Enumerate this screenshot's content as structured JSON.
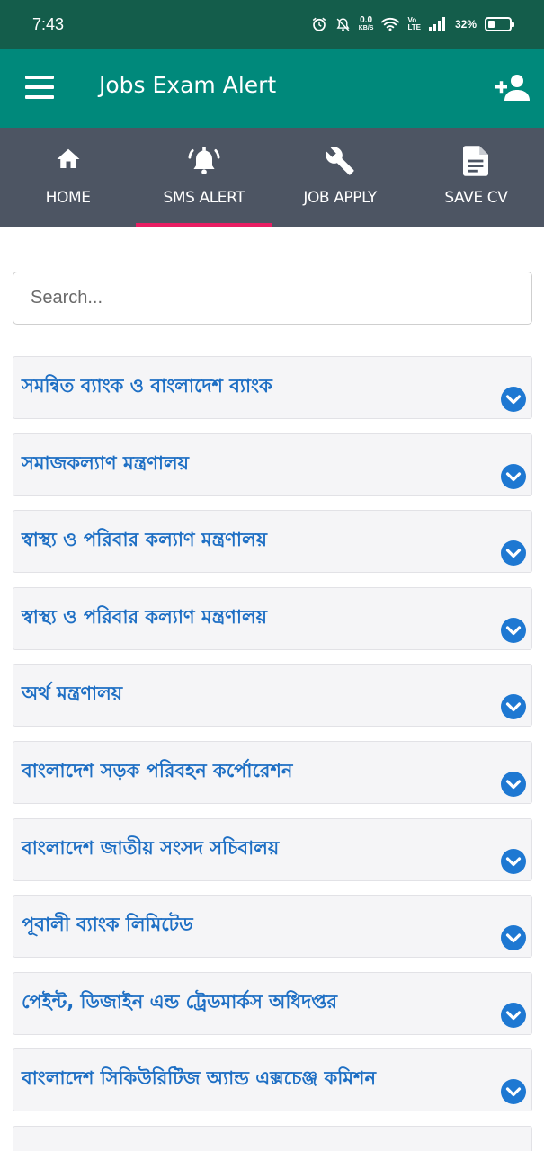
{
  "status_bar": {
    "time": "7:43",
    "speed_value": "0.0",
    "speed_unit": "KB/S",
    "volte_top": "Vo",
    "volte_bottom": "LTE",
    "battery_percent": "32%",
    "battery_level": 0.32
  },
  "app_bar": {
    "title": "Jobs Exam Alert",
    "color": "#00897b"
  },
  "tabs": [
    {
      "label": "HOME",
      "icon": "home-icon",
      "active": false
    },
    {
      "label": "SMS ALERT",
      "icon": "alarm-bell-icon",
      "active": true
    },
    {
      "label": "JOB APPLY",
      "icon": "wrench-icon",
      "active": false
    },
    {
      "label": "SAVE CV",
      "icon": "document-icon",
      "active": false
    }
  ],
  "search": {
    "placeholder": "Search...",
    "value": ""
  },
  "items": [
    "সমন্বিত ব্যাংক ও বাংলাদেশ ব্যাংক",
    "সমাজকল্যাণ মন্ত্রণালয়",
    "স্বাস্থ্য ও পরিবার কল্যাণ মন্ত্রণালয়",
    "স্বাস্থ্য ও পরিবার কল্যাণ মন্ত্রণালয়",
    "অর্থ মন্ত্রণালয়",
    "বাংলাদেশ সড়ক পরিবহন কর্পোরেশন",
    "বাংলাদেশ জাতীয় সংসদ সচিবালয়",
    "পূবালী ব্যাংক লিমিটেড",
    "পেইন্ট, ডিজাইন এন্ড ট্রেডমার্কস অধিদপ্তর",
    "বাংলাদেশ সিকিউরিটিজ অ্যান্ড এক্সচেঞ্জ কমিশন"
  ],
  "colors": {
    "status_bar": "#145d4b",
    "tab_bar": "#4d5563",
    "tab_indicator": "#e91e63",
    "item_text": "#1e6fc4",
    "chevron": "#1e78d2"
  }
}
